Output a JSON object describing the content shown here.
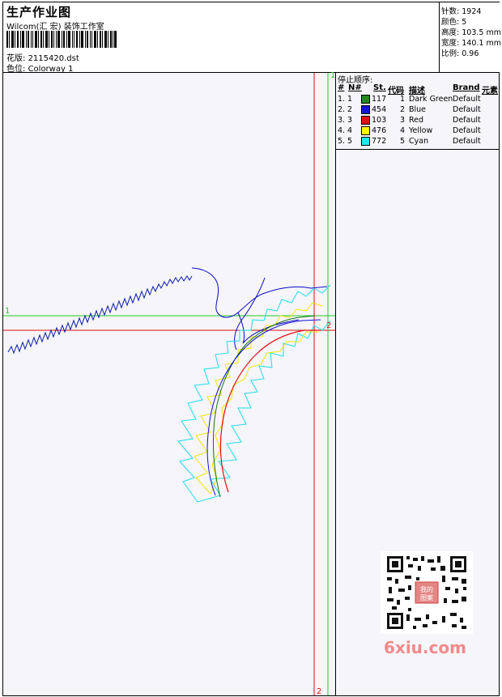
{
  "header": {
    "title": "生产作业图",
    "company": "Wilcom(汇 宏) 装饰工作室",
    "file_label": "花版:",
    "file_name": "2115420.dst",
    "colorway_label": "色位:",
    "colorway_name": "Colorway 1"
  },
  "stats": [
    {
      "label": "针数:",
      "value": "1924"
    },
    {
      "label": "颜色:",
      "value": "5"
    },
    {
      "label": "高度:",
      "value": "103.5 mm"
    },
    {
      "label": "宽度:",
      "value": "140.1 mm"
    },
    {
      "label": "比例:",
      "value": "0.96"
    }
  ],
  "guides": {
    "green_mark": "1",
    "red_mark": "2",
    "top_mark": "1",
    "bottom_mark": "2"
  },
  "stop_sequence": {
    "title": "停止顺序:",
    "columns": [
      "#",
      "N#",
      "St.",
      "代码",
      "描述",
      "Brand",
      "元素"
    ],
    "rows": [
      {
        "idx": "1.",
        "n": "1",
        "color": "#1f8a1f",
        "st": "117",
        "code": "1",
        "desc": "Dark Green",
        "brand": "Default"
      },
      {
        "idx": "2.",
        "n": "2",
        "color": "#1414d2",
        "st": "454",
        "code": "2",
        "desc": "Blue",
        "brand": "Default"
      },
      {
        "idx": "3.",
        "n": "3",
        "color": "#e01010",
        "st": "103",
        "code": "3",
        "desc": "Red",
        "brand": "Default"
      },
      {
        "idx": "4.",
        "n": "4",
        "color": "#ffff00",
        "st": "476",
        "code": "4",
        "desc": "Yellow",
        "brand": "Default"
      },
      {
        "idx": "5.",
        "n": "5",
        "color": "#22e8f0",
        "st": "772",
        "code": "5",
        "desc": "Cyan",
        "brand": "Default"
      }
    ]
  },
  "watermark": {
    "text": "6xiu.com",
    "stamp": "我的图案"
  }
}
